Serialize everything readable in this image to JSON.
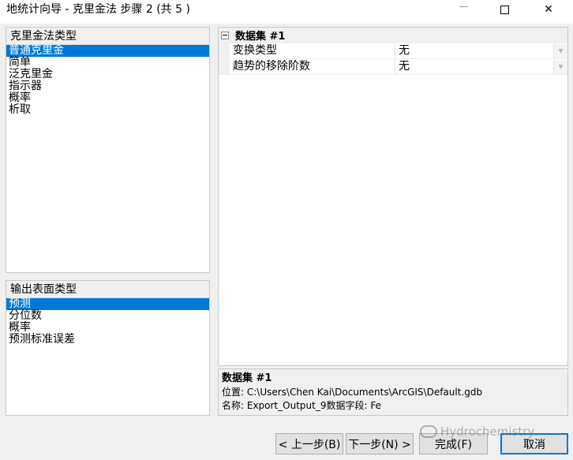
{
  "window": {
    "title": "地统计向导 - 克里金法 步骤 2 (共 5 )",
    "close_glyph": "✕"
  },
  "kriging_type": {
    "header": "克里金法类型",
    "items": [
      "普通克里金",
      "简单",
      "泛克里金",
      "指示器",
      "概率",
      "析取"
    ],
    "selected_index": 0
  },
  "output_type": {
    "header": "输出表面类型",
    "items": [
      "预测",
      "分位数",
      "概率",
      "预测标准误差"
    ],
    "selected_index": 0
  },
  "property_grid": {
    "group_label": "数据集 #1",
    "rows": [
      {
        "name": "变换类型",
        "value": "无"
      },
      {
        "name": "趋势的移除阶数",
        "value": "无"
      }
    ]
  },
  "description": {
    "title": "数据集 #1",
    "location": "位置: C:\\Users\\Chen Kai\\Documents\\ArcGIS\\Default.gdb",
    "name": "名称: Export_Output_9数据字段: Fe"
  },
  "buttons": {
    "back": "< 上一步(B)",
    "next": "下一步(N) >",
    "finish": "完成(F)",
    "cancel": "取消"
  },
  "watermark": "Hydrochemistry",
  "colors": {
    "selection": "#0078d7",
    "window_bg": "#f0f0f0"
  }
}
